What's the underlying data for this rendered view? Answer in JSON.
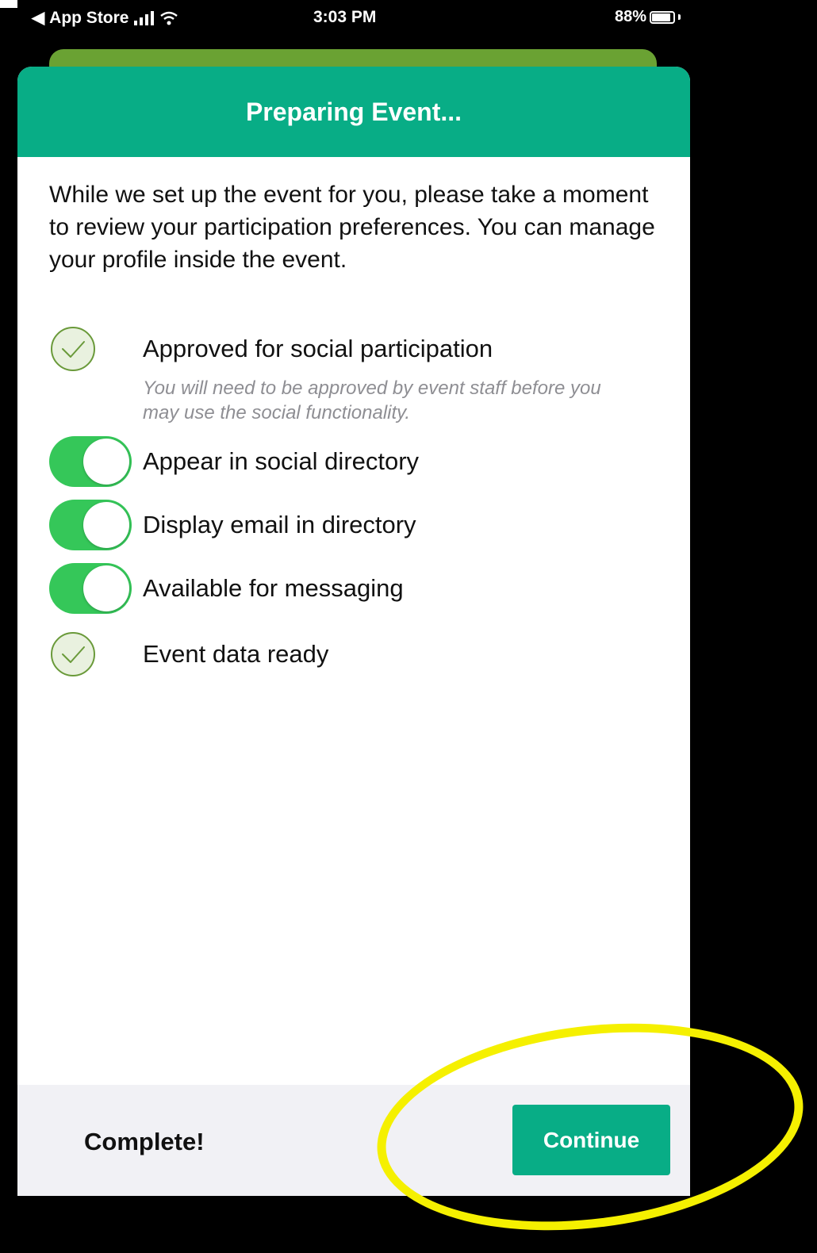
{
  "status_bar": {
    "back_app": "App Store",
    "time": "3:03 PM",
    "battery": "88%"
  },
  "modal": {
    "title": "Preparing Event...",
    "intro": "While we set up the event for you, please take a moment to review your participation preferences. You can manage your profile inside the event.",
    "items": [
      {
        "type": "check",
        "label": "Approved for social participation",
        "note": "You will need to be approved by event staff before you may use the social functionality.",
        "icon": "check-circle-icon"
      },
      {
        "type": "toggle",
        "label": "Appear in social directory",
        "on": true
      },
      {
        "type": "toggle",
        "label": "Display email in directory",
        "on": true
      },
      {
        "type": "toggle",
        "label": "Available for messaging",
        "on": true
      },
      {
        "type": "check",
        "label": "Event data ready",
        "icon": "check-circle-icon"
      }
    ]
  },
  "footer": {
    "status": "Complete!",
    "continue_label": "Continue"
  },
  "colors": {
    "header": "#08ad86",
    "back_card": "#6aa233",
    "toggle_on": "#35c759",
    "highlight": "#f5f000"
  }
}
